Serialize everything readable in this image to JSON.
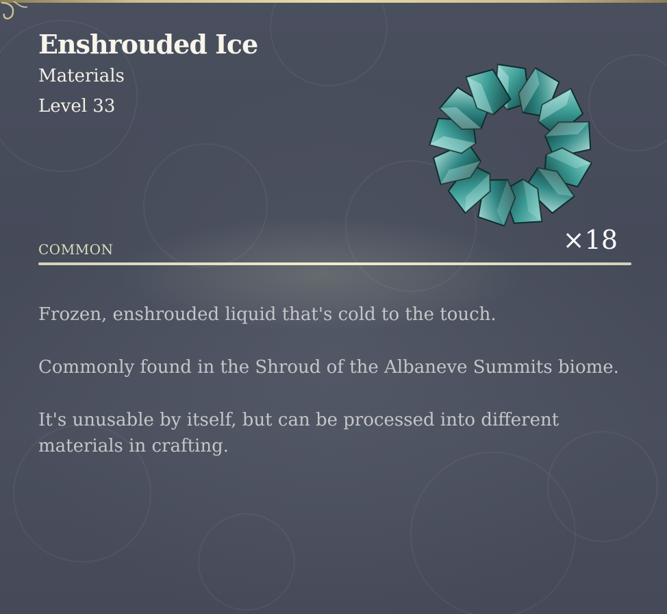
{
  "item": {
    "name": "Enshrouded Ice",
    "category": "Materials",
    "level": "Level 33",
    "rarity": "COMMON",
    "quantity": "×18",
    "icon": "ice-ring-icon"
  },
  "description": {
    "paragraphs": [
      "Frozen, enshrouded liquid that's cold to the touch.",
      "Commonly found in the Shroud of the Albaneve Summits biome.",
      "It's unusable by itself, but can be processed into different materials in crafting."
    ]
  },
  "colors": {
    "background": "#474c5b",
    "title": "#f7f4ea",
    "rarity": "#d9deb8",
    "description_text": "#c4c6c8",
    "border_gold": "#e6dcae",
    "ice_teal": "#2f8784"
  }
}
